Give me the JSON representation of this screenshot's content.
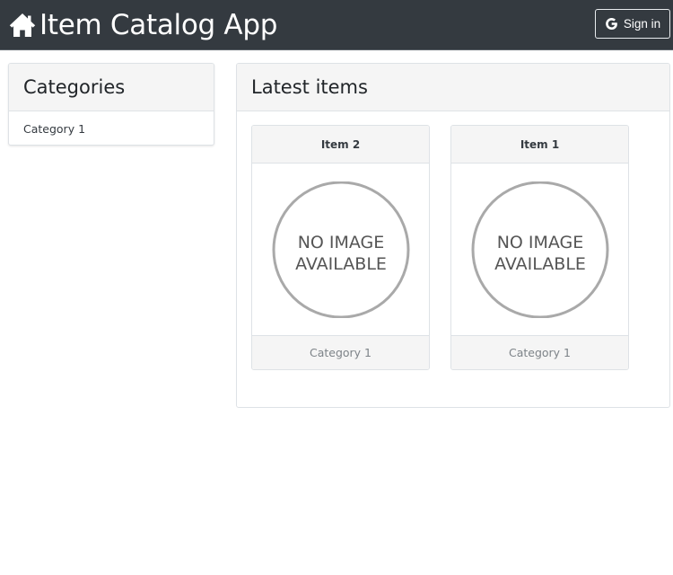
{
  "navbar": {
    "brand_text": "Item Catalog App",
    "brand_icon": "home-icon",
    "signin_label": "Sign in",
    "signin_icon": "google-icon",
    "background": "#343a40"
  },
  "categories_panel": {
    "title": "Categories",
    "items": [
      {
        "label": "Category 1"
      }
    ]
  },
  "latest_panel": {
    "title": "Latest items",
    "items": [
      {
        "name": "Item 2",
        "image_text": [
          "NO IMAGE",
          "AVAILABLE"
        ],
        "category": "Category 1"
      },
      {
        "name": "Item 1",
        "image_text": [
          "NO IMAGE",
          "AVAILABLE"
        ],
        "category": "Category 1"
      }
    ]
  }
}
